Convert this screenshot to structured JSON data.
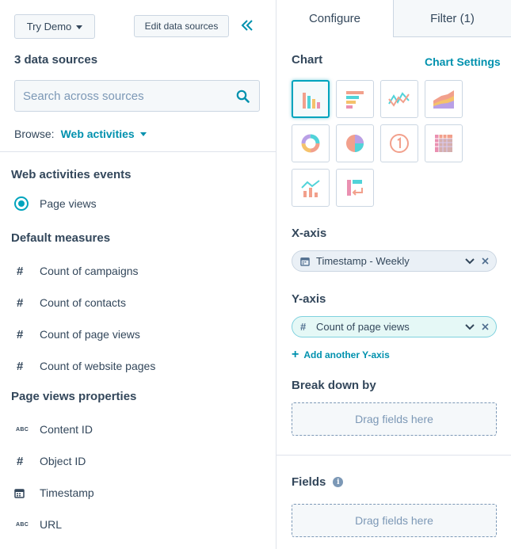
{
  "left": {
    "try_demo_label": "Try Demo",
    "edit_sources_label": "Edit data sources",
    "data_sources_count": "3 data sources",
    "search_placeholder": "Search across sources",
    "browse_label": "Browse:",
    "browse_value": "Web activities",
    "sections": [
      {
        "title": "Web activities events",
        "items": [
          {
            "label": "Page views",
            "icon": "radio-selected-icon"
          }
        ]
      },
      {
        "title": "Default measures",
        "items": [
          {
            "label": "Count of campaigns",
            "icon": "hash-icon"
          },
          {
            "label": "Count of contacts",
            "icon": "hash-icon"
          },
          {
            "label": "Count of page views",
            "icon": "hash-icon"
          },
          {
            "label": "Count of website pages",
            "icon": "hash-icon"
          }
        ]
      },
      {
        "title": "Page views properties",
        "items": [
          {
            "label": "Content ID",
            "icon": "abc-text-icon"
          },
          {
            "label": "Object ID",
            "icon": "hash-icon"
          },
          {
            "label": "Timestamp",
            "icon": "calendar-icon"
          },
          {
            "label": "URL",
            "icon": "abc-text-icon"
          }
        ]
      }
    ]
  },
  "right": {
    "tabs": [
      {
        "label": "Configure",
        "active": true
      },
      {
        "label": "Filter (1)",
        "active": false
      }
    ],
    "chart_title": "Chart",
    "chart_settings_label": "Chart Settings",
    "chart_types": [
      "vertical-bar",
      "horizontal-bar",
      "line",
      "area",
      "donut",
      "pie",
      "summary",
      "pivot-table",
      "combination",
      "funnel"
    ],
    "selected_chart_type": "vertical-bar",
    "x_axis": {
      "title": "X-axis",
      "value": "Timestamp - Weekly",
      "icon": "calendar-icon"
    },
    "y_axis": {
      "title": "Y-axis",
      "value": "Count of page views",
      "icon": "hash-icon"
    },
    "add_y_label": "Add another Y-axis",
    "breakdown_title": "Break down by",
    "drag_placeholder": "Drag fields here",
    "fields_title": "Fields"
  },
  "colors": {
    "accent": "#00a4bd",
    "link": "#0091ae",
    "text": "#33475b",
    "muted": "#7c98b6",
    "border": "#cbd6e2"
  }
}
